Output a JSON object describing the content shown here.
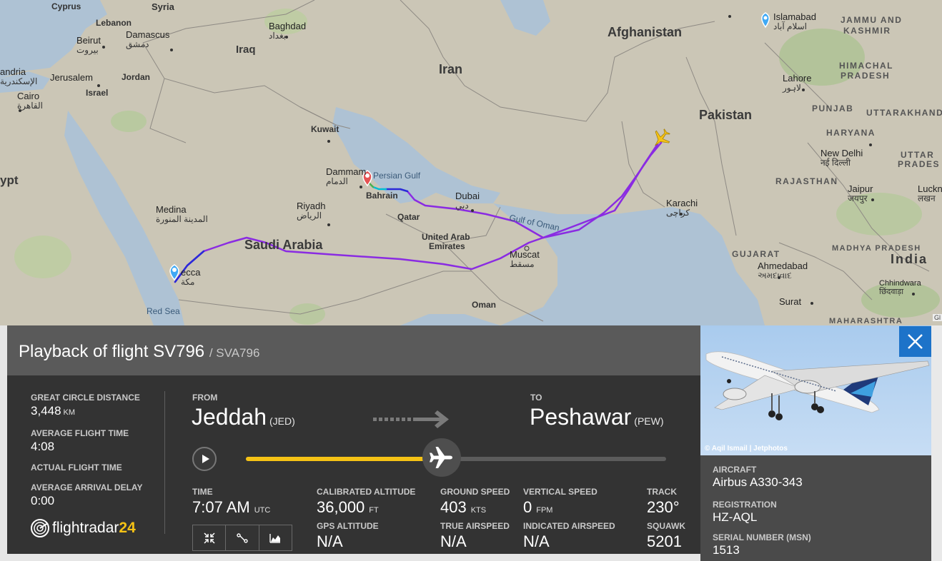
{
  "map": {
    "edge_fragment": "Gl",
    "countries": [
      {
        "name": "Afghanistan"
      },
      {
        "name": "Iran"
      },
      {
        "name": "Iraq"
      },
      {
        "name": "Pakistan"
      },
      {
        "name": "Saudi Arabia"
      },
      {
        "name": "India"
      },
      {
        "name": "Syria"
      },
      {
        "name": "Cyprus"
      },
      {
        "name": "Lebanon"
      },
      {
        "name": "Jordan"
      },
      {
        "name": "Israel"
      },
      {
        "name": "Kuwait"
      },
      {
        "name": "Qatar"
      },
      {
        "name": "Bahrain"
      },
      {
        "name": "Oman"
      },
      {
        "name": "United Arab"
      },
      {
        "name": "Emirates"
      },
      {
        "name": "ypt"
      }
    ],
    "cities": [
      {
        "name": "Baghdad",
        "native": "بغداد"
      },
      {
        "name": "Beirut",
        "native": "بيروت"
      },
      {
        "name": "Damascus",
        "native": "دمشق"
      },
      {
        "name": "Jerusalem",
        "native": ""
      },
      {
        "name": "Cairo",
        "native": "القاهرة"
      },
      {
        "name": "andria",
        "native": "الإسكندرية"
      },
      {
        "name": "Dammam",
        "native": "الدمام"
      },
      {
        "name": "Riyadh",
        "native": "الرياض"
      },
      {
        "name": "Medina",
        "native": "المدينة المنورة"
      },
      {
        "name": "ecca",
        "native": "مكة"
      },
      {
        "name": "Dubai",
        "native": "دبي"
      },
      {
        "name": "Muscat",
        "native": "مسقط"
      },
      {
        "name": "Karachi",
        "native": "کراچی"
      },
      {
        "name": "Islamabad",
        "native": "اسلام آباد"
      },
      {
        "name": "Lahore",
        "native": "لاہور"
      },
      {
        "name": "New Delhi",
        "native": "नई दिल्ली"
      },
      {
        "name": "Jaipur",
        "native": "जयपुर"
      },
      {
        "name": "Luckn",
        "native": "लखन"
      },
      {
        "name": "Ahmedabad",
        "native": "અમદાવાદ"
      },
      {
        "name": "Chhindwara",
        "native": "छिंदवाड़ा"
      },
      {
        "name": "Surat",
        "native": ""
      }
    ],
    "regions": [
      "JAMMU AND",
      "KASHMIR",
      "HIMACHAL",
      "PRADESH",
      "PUNJAB",
      "UTTARAKHAND",
      "HARYANA",
      "UTTAR",
      "PRADES",
      "RAJASTHAN",
      "GUJARAT",
      "MADHYA PRADESH",
      "MAHARASHTRA"
    ],
    "waters": [
      "Persian Gulf",
      "Gulf of Oman",
      "Red Sea"
    ],
    "route_colors": [
      "#8a2be2",
      "#2222dd",
      "#00bcd4",
      "#4caf50"
    ]
  },
  "flight": {
    "title": "Playback of flight SV796",
    "callsign": "/ SVA796",
    "stats": [
      {
        "label": "GREAT CIRCLE DISTANCE",
        "value": "3,448",
        "unit": "KM"
      },
      {
        "label": "AVERAGE FLIGHT TIME",
        "value": "4:08",
        "unit": ""
      },
      {
        "label": "ACTUAL FLIGHT TIME",
        "value": "",
        "unit": ""
      },
      {
        "label": "AVERAGE ARRIVAL DELAY",
        "value": "0:00",
        "unit": ""
      }
    ],
    "from_label": "FROM",
    "from_city": "Jeddah",
    "from_code": "(JED)",
    "to_label": "TO",
    "to_city": "Peshawar",
    "to_code": "(PEW)",
    "playback_progress": 0.5,
    "telemetry": {
      "time_label": "TIME",
      "time_value": "7:07 AM",
      "time_unit": "UTC",
      "cal_alt_label": "CALIBRATED ALTITUDE",
      "cal_alt_value": "36,000",
      "cal_alt_unit": "FT",
      "gps_alt_label": "GPS ALTITUDE",
      "gps_alt_value": "N/A",
      "ground_speed_label": "GROUND SPEED",
      "ground_speed_value": "403",
      "ground_speed_unit": "KTS",
      "true_airspeed_label": "TRUE AIRSPEED",
      "true_airspeed_value": "N/A",
      "vertical_speed_label": "VERTICAL SPEED",
      "vertical_speed_value": "0",
      "vertical_speed_unit": "FPM",
      "indicated_airspeed_label": "INDICATED AIRSPEED",
      "indicated_airspeed_value": "N/A",
      "track_label": "TRACK",
      "track_value": "230°",
      "squawk_label": "SQUAWK",
      "squawk_value": "5201"
    },
    "logo": {
      "text": "flightradar",
      "num": "24"
    }
  },
  "aircraft": {
    "photo_credit": "© Aqil Ismail | Jetphotos",
    "aircraft_label": "AIRCRAFT",
    "aircraft_value": "Airbus A330-343",
    "registration_label": "REGISTRATION",
    "registration_value": "HZ-AQL",
    "serial_label": "SERIAL NUMBER (MSN)",
    "serial_value": "1513"
  },
  "colors": {
    "accent_yellow": "#f5c215",
    "close_blue": "#1d73c9",
    "panel_dark": "#333333"
  }
}
